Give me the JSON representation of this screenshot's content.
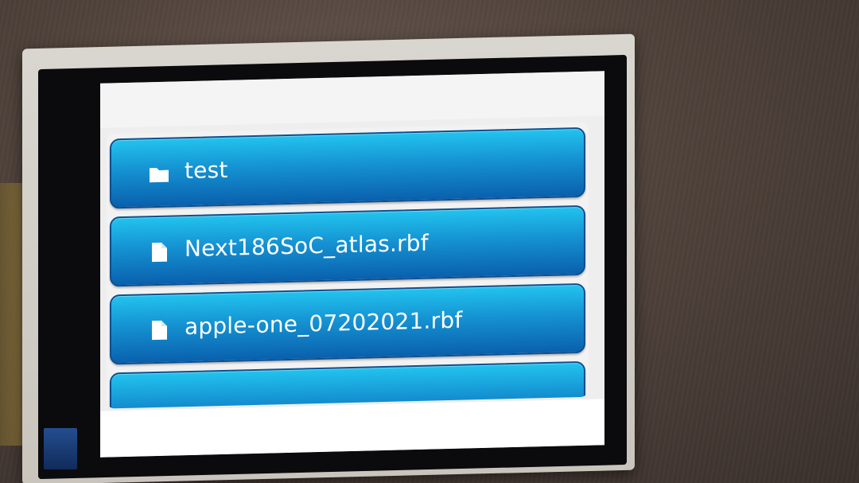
{
  "file_list": {
    "items": [
      {
        "type": "folder",
        "icon": "folder-icon",
        "label": "test"
      },
      {
        "type": "file",
        "icon": "file-icon",
        "label": "Next186SoC_atlas.rbf"
      },
      {
        "type": "file",
        "icon": "file-icon",
        "label": "apple-one_07202021.rbf"
      },
      {
        "type": "file",
        "icon": "file-icon",
        "label": ""
      }
    ]
  },
  "colors": {
    "item_top": "#22c3ee",
    "item_bottom": "#0a60ad",
    "screen_bg": "#eeeeee"
  }
}
